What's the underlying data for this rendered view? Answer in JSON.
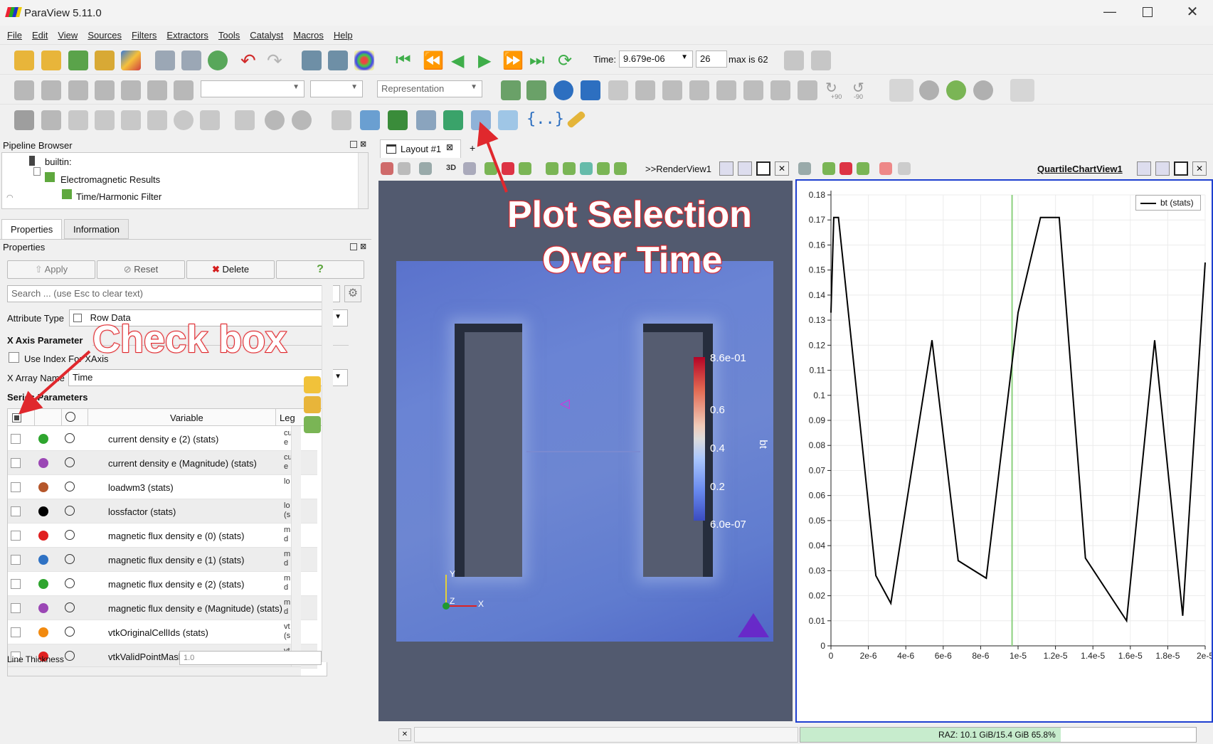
{
  "window": {
    "title": "ParaView 5.11.0"
  },
  "menu": [
    "File",
    "Edit",
    "View",
    "Sources",
    "Filters",
    "Extractors",
    "Tools",
    "Catalyst",
    "Macros",
    "Help"
  ],
  "toolbar": {
    "time_label": "Time:",
    "time_value": "9.679e-06",
    "timestep": "26",
    "max_label": "max is 62",
    "representation": "Representation",
    "rot_plus": "+90",
    "rot_minus": "-90"
  },
  "pipeline": {
    "title": "Pipeline Browser",
    "items": [
      "builtin:",
      "Electromagnetic Results",
      "Time/Harmonic Filter"
    ]
  },
  "tabs": {
    "properties": "Properties",
    "information": "Information"
  },
  "properties": {
    "title": "Properties",
    "apply": "Apply",
    "reset": "Reset",
    "delete": "Delete",
    "help": "?",
    "search_placeholder": "Search ... (use Esc to clear text)",
    "attribute_type_label": "Attribute Type",
    "attribute_type_value": "Row Data",
    "x_axis_section": "X Axis Parameter",
    "use_index_label": "Use Index For XAxis",
    "x_array_label": "X Array Name",
    "x_array_value": "Time",
    "series_section": "Series Parameters",
    "table_header_variable": "Variable",
    "table_header_legend": "Leg",
    "line_thickness_label": "Line Thickness",
    "line_thickness_value": "1.0"
  },
  "series": [
    {
      "variable": "current density e (2) (stats)",
      "color": "#2ea52e",
      "legend": "cu e"
    },
    {
      "variable": "current density e (Magnitude) (stats)",
      "color": "#9b47b5",
      "legend": "cu e"
    },
    {
      "variable": "loadwm3 (stats)",
      "color": "#b5562a",
      "legend": "lo"
    },
    {
      "variable": "lossfactor (stats)",
      "color": "#000000",
      "legend": "lo (s"
    },
    {
      "variable": "magnetic flux density e (0) (stats)",
      "color": "#e01f1f",
      "legend": "m d"
    },
    {
      "variable": "magnetic flux density e (1) (stats)",
      "color": "#2f72c4",
      "legend": "m d"
    },
    {
      "variable": "magnetic flux density e (2) (stats)",
      "color": "#2ea52e",
      "legend": "m d"
    },
    {
      "variable": "magnetic flux density e (Magnitude) (stats)",
      "color": "#9b47b5",
      "legend": "m d"
    },
    {
      "variable": "vtkOriginalCellIds (stats)",
      "color": "#f28a0f",
      "legend": "vt (s"
    },
    {
      "variable": "vtkValidPointMask (stats)",
      "color": "#e01f1f",
      "legend": "vt (s"
    }
  ],
  "layout": {
    "tab": "Layout #1",
    "add": "+",
    "render_view": "RenderView1",
    "chart_view": "QuartileChartView1",
    "mode_3d": "3D"
  },
  "colorbar": {
    "title": "bt",
    "max": "8.6e-01",
    "t1": "0.6",
    "t2": "0.4",
    "t3": "0.2",
    "min": "6.0e-07"
  },
  "axes_triad": {
    "x": "X",
    "y": "Y",
    "z": "Z"
  },
  "annotations": {
    "plot_selection_line1": "Plot Selection",
    "plot_selection_line2": "Over Time",
    "check_box": "Check box"
  },
  "status": {
    "memory": "RAZ: 10.1 GiB/15.4 GiB 65.8%"
  },
  "colors": {
    "accent": "#1e3fd0",
    "plot_line": "#000000",
    "time_marker": "#8bd07e",
    "callout": "#e0282d"
  },
  "chart_data": {
    "type": "line",
    "legend": "bt (stats)",
    "legend_position": "top-right",
    "x": [
      0,
      1.5e-07,
      4e-07,
      2.4e-06,
      3.2e-06,
      5.4e-06,
      6.8e-06,
      8.3e-06,
      1e-05,
      1.12e-05,
      1.22e-05,
      1.36e-05,
      1.58e-05,
      1.73e-05,
      1.88e-05,
      2e-05
    ],
    "y": [
      0.133,
      0.171,
      0.171,
      0.028,
      0.017,
      0.122,
      0.034,
      0.027,
      0.133,
      0.171,
      0.171,
      0.035,
      0.01,
      0.122,
      0.012,
      0.153
    ],
    "xlim": [
      0,
      2e-05
    ],
    "ylim": [
      0,
      0.18
    ],
    "xticks": [
      "0",
      "2e-6",
      "4e-6",
      "6e-6",
      "8e-6",
      "1e-5",
      "1.2e-5",
      "1.4e-5",
      "1.6e-5",
      "1.8e-5",
      "2e-5"
    ],
    "yticks": [
      "0",
      "0.01",
      "0.02",
      "0.03",
      "0.04",
      "0.05",
      "0.06",
      "0.07",
      "0.08",
      "0.09",
      "0.1",
      "0.11",
      "0.12",
      "0.13",
      "0.14",
      "0.15",
      "0.16",
      "0.17",
      "0.18"
    ],
    "time_marker_x": 9.679e-06,
    "grid": true
  }
}
